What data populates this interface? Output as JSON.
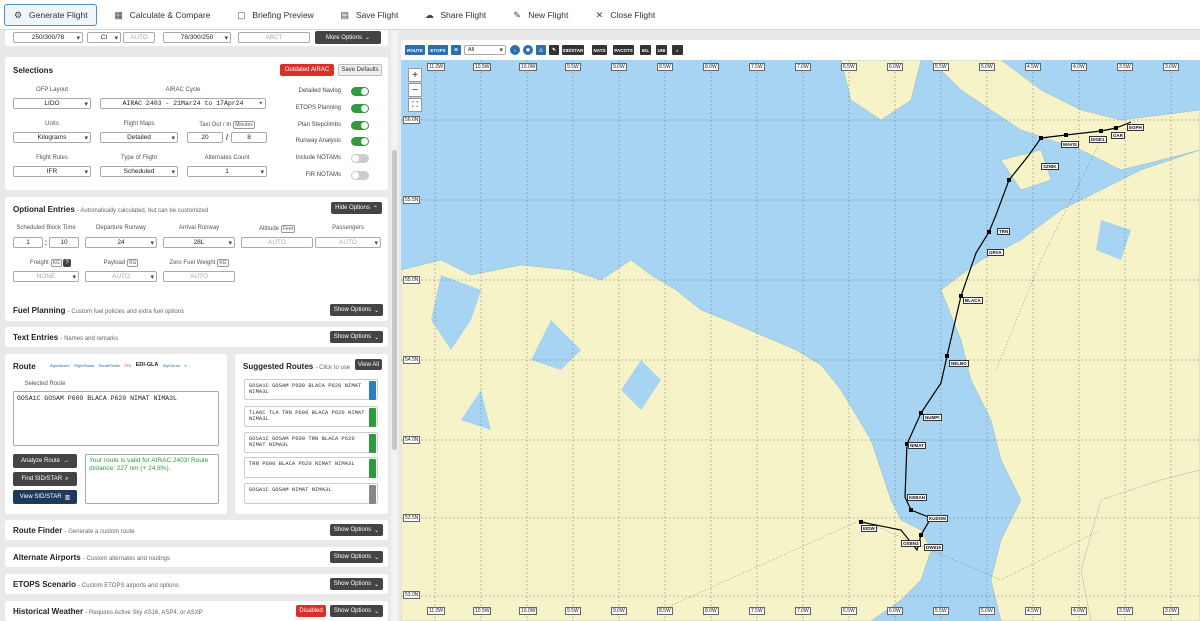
{
  "toolbar": {
    "items": [
      {
        "label": "Generate Flight",
        "icon": "gear-icon"
      },
      {
        "label": "Calculate & Compare",
        "icon": "calculator-icon"
      },
      {
        "label": "Briefing Preview",
        "icon": "document-icon"
      },
      {
        "label": "Save Flight",
        "icon": "calendar-icon"
      },
      {
        "label": "Share Flight",
        "icon": "cloud-icon"
      },
      {
        "label": "New Flight",
        "icon": "pencil-icon"
      },
      {
        "label": "Close Flight",
        "icon": "close-icon"
      }
    ]
  },
  "top_row": {
    "a": "250/300/78",
    "b": "CI",
    "c": "AUTO",
    "d": "78/300/250",
    "e": "ABCT",
    "more": "More Options"
  },
  "selections": {
    "title": "Selections",
    "outdated": "Outdated AIRAC",
    "save_defaults": "Save Defaults",
    "ofp_label": "OFP Layout",
    "ofp": "LIDO",
    "airac_label": "AIRAC Cycle",
    "airac": "AIRAC 2403 - 21Mar24 to 17Apr24",
    "units_label": "Units",
    "units": "Kilograms",
    "maps_label": "Flight Maps",
    "maps": "Detailed",
    "taxi_label": "Taxi Out / In",
    "taxi_unit": "Minutes",
    "taxi_out": "20",
    "taxi_sep": "/",
    "taxi_in": "8",
    "rules_label": "Flight Rules",
    "rules": "IFR",
    "type_label": "Type of Flight",
    "type": "Scheduled",
    "alt_label": "Alternates Count",
    "alt": "1",
    "toggles": [
      {
        "label": "Detailed Navlog",
        "on": true
      },
      {
        "label": "ETOPS Planning",
        "on": true
      },
      {
        "label": "Plan Stepclimbs",
        "on": true
      },
      {
        "label": "Runway Analysis",
        "on": true
      },
      {
        "label": "Include NOTAMs",
        "on": false
      },
      {
        "label": "FIR NOTAMs",
        "on": false
      }
    ]
  },
  "optional": {
    "title": "Optional Entries",
    "subtitle": "- Automatically calculated, but can be customized",
    "hide": "Hide Options",
    "sbt_label": "Scheduled Block Time",
    "sbt_h": "1",
    "sbt_sep": ":",
    "sbt_m": "10",
    "dep_rwy_label": "Departure Runway",
    "dep_rwy": "24",
    "arr_rwy_label": "Arrival Runway",
    "arr_rwy": "28L",
    "alt_label": "Altitude",
    "alt_unit": "Feet",
    "alt": "AUTO",
    "pax_label": "Passengers",
    "pax": "AUTO",
    "freight_label": "Freight",
    "freight_unit": "KG",
    "freight": "NONE",
    "payload_label": "Payload",
    "payload_unit": "KG",
    "payload": "AUTO",
    "zfw_label": "Zero Fuel Weight",
    "zfw_unit": "KG",
    "zfw": "AUTO"
  },
  "fuel": {
    "title": "Fuel Planning",
    "subtitle": "- Custom fuel policies and extra fuel options",
    "btn": "Show Options"
  },
  "text": {
    "title": "Text Entries",
    "subtitle": "- Names and remarks",
    "btn": "Show Options"
  },
  "route": {
    "title": "Route",
    "providers": [
      "flightAware",
      "FlightRadar",
      "RouteFinder",
      "FPL",
      "EDI-GLA",
      "SkyVector",
      "e"
    ],
    "selected_label": "Selected Route",
    "selected": "GOSA1C GOSAM P600 BLACA P620 NIMAT NIMA3L",
    "analyze": "Analyze Route",
    "find": "Find SID/STAR",
    "view": "View SID/STAR",
    "valid": "Your route is valid for AIRAC 2403! Route distance: 227 nm (+ 24.8%)."
  },
  "suggested": {
    "title": "Suggested Routes",
    "subtitle": "- Click to use",
    "view_all": "View All",
    "items": [
      {
        "text": "GOSA1C GOSAM P600 BLACA P620 NIMAT NIMA3L",
        "color": "#2b7fc0"
      },
      {
        "text": "TLA6C TLA TRN P600 BLACA P620 NIMAT NIMA3L",
        "color": "#2e9c3e"
      },
      {
        "text": "GOSA1C GOSAM P600 TRN BLACA P620 NIMAT NIMA3L",
        "color": "#2e9c3e"
      },
      {
        "text": "TRN P600 BLACA P620 NIMAT NIMA3L",
        "color": "#2e9c3e"
      },
      {
        "text": "GOSA1C GOSAM NIMAT NIMA3L",
        "color": "#888888"
      }
    ]
  },
  "route_finder": {
    "title": "Route Finder",
    "subtitle": "- Generate a custom route",
    "btn": "Show Options"
  },
  "alternates": {
    "title": "Alternate Airports",
    "subtitle": "- Custom alternates and routings",
    "btn": "Show Options"
  },
  "etops": {
    "title": "ETOPS Scenario",
    "subtitle": "- Custom ETOPS airports and options",
    "btn": "Show Options"
  },
  "weather": {
    "title": "Historical Weather",
    "subtitle": "- Requires Active Sky AS16, ASP4, or ASXP",
    "disabled": "Disabled",
    "btn": "Show Options"
  },
  "map": {
    "tools": [
      "ROUTE",
      "ETOPS",
      "SID/STAR",
      "NATS",
      "PACOTS",
      "IDL",
      "UNI"
    ],
    "layer": "All",
    "lon_labels": [
      "11.0W",
      "10.5W",
      "10.0W",
      "9.5W",
      "9.0W",
      "8.5W",
      "8.0W",
      "7.5W",
      "7.0W",
      "6.5W",
      "6.0W",
      "5.5W",
      "5.0W",
      "4.5W",
      "4.0W",
      "3.5W",
      "3.0W"
    ],
    "lat_labels": [
      "56.0N",
      "55.5N",
      "55.0N",
      "54.5N",
      "54.0N",
      "53.5N",
      "53.0N"
    ],
    "waypoints": [
      "EGPH",
      "GAR",
      "DIGE1",
      "MAVIS",
      "SZNIK",
      "TRN",
      "GRVA",
      "BLACA",
      "NELBO",
      "NUMPI",
      "NIMAT",
      "KEBAH",
      "KUDOM",
      "DW815",
      "OSBN3",
      "EIDW"
    ],
    "colors": {
      "sea": "#a7d4f2",
      "land": "#f7f3c9",
      "route": "#000000"
    }
  }
}
